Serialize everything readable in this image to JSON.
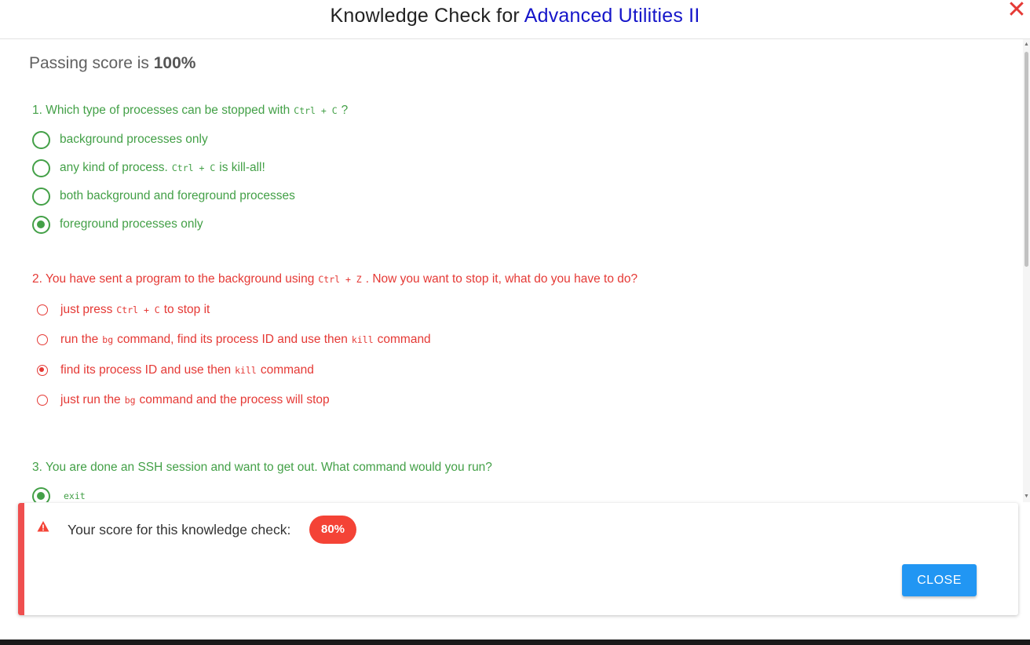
{
  "header": {
    "title_prefix": "Knowledge Check for",
    "title_link": "Advanced Utilities II",
    "close_glyph": "✕"
  },
  "passing": {
    "label": "Passing score is",
    "value": "100%"
  },
  "questions": [
    {
      "status": "correct",
      "text_before": "1. Which type of processes can be stopped with",
      "code": "Ctrl + C",
      "text_after": "?",
      "options": [
        {
          "parts": [
            "background processes only"
          ],
          "selected": false
        },
        {
          "parts": [
            "any kind of process.",
            "Ctrl + C",
            "is kill-all!"
          ],
          "selected": false
        },
        {
          "parts": [
            "both background and foreground processes"
          ],
          "selected": false
        },
        {
          "parts": [
            "foreground processes only"
          ],
          "selected": true
        }
      ]
    },
    {
      "status": "incorrect",
      "text_before": "2. You have sent a program to the background using",
      "code": "Ctrl + Z",
      "text_after": ". Now you want to stop it, what do you have to do?",
      "options": [
        {
          "parts": [
            "just press",
            "Ctrl + C",
            "to stop it"
          ],
          "selected": false
        },
        {
          "parts": [
            "run the",
            "bg",
            "command, find its process ID and use then",
            "kill",
            "command"
          ],
          "selected": false
        },
        {
          "parts": [
            "find its process ID and use then",
            "kill",
            "command"
          ],
          "selected": true
        },
        {
          "parts": [
            "just run the",
            "bg",
            "command and the process will stop"
          ],
          "selected": false
        }
      ]
    },
    {
      "status": "correct",
      "text": "3. You are done an SSH session and want to get out. What command would you run?",
      "options": [
        {
          "parts": [
            "exit"
          ],
          "selected": true
        }
      ]
    }
  ],
  "score": {
    "label": "Your score for this knowledge check:",
    "value": "80%",
    "icon": "warning-icon"
  },
  "close_button": "CLOSE",
  "colors": {
    "correct": "#43a047",
    "incorrect": "#e53935",
    "link": "#1515c9",
    "button": "#2196f3",
    "badge": "#f44336"
  }
}
